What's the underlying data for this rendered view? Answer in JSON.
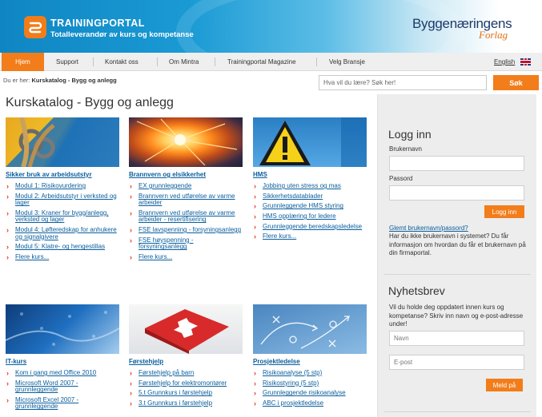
{
  "header": {
    "brand_name": "TRAININGPORTAL",
    "brand_tagline": "Totalleverandør av kurs og kompetanse",
    "partner_line1": "Byggenæringens",
    "partner_line2": "Forlag",
    "brand_color": "#f27d1a"
  },
  "nav": {
    "items": [
      {
        "label": "Hjem"
      },
      {
        "label": "Support"
      },
      {
        "label": "Kontakt oss"
      },
      {
        "label": "Om Mintra"
      },
      {
        "label": "Trainingportal Magazine"
      },
      {
        "label": "Velg Bransje"
      }
    ],
    "language": "English"
  },
  "breadcrumb": {
    "prefix": "Du er her:",
    "current": "Kurskatalog - Bygg og anlegg"
  },
  "search": {
    "placeholder": "Hva vil du lære? Søk her!",
    "button": "Søk"
  },
  "page_title": "Kurskatalog - Bygg og anlegg",
  "categories": [
    {
      "title": "Sikker bruk av arbeidsutstyr",
      "items": [
        "Modul 1: Risikovurdering",
        "Modul 2: Arbeidsutstyr i verksted og lager",
        "Modul 3: Kraner for bygg/anlegg, verksted og lager",
        "Modul 4: Løfteredskap for anhukere og signalgivere",
        "Modul 5: Klatre- og hengestillas",
        "Flere kurs..."
      ]
    },
    {
      "title": "Brannvern og elsikkerhet",
      "items": [
        "EX grunnleggende",
        "Brannvern ved utførelse av varme arbeider",
        "Brannvern ved utførelse av varme arbeider - resertifisering",
        "FSE lavspenning - forsyningsanlegg",
        "FSE høyspenning - forsyningsanlegg",
        "Flere kurs..."
      ]
    },
    {
      "title": "HMS",
      "items": [
        "Jobbing uten stress og mas",
        "Sikkerhetsdatablader",
        "Grunnleggende HMS styring",
        "HMS opplæring for ledere",
        "Grunnleggende beredskapsledelse",
        "Flere kurs..."
      ]
    },
    {
      "title": "IT-kurs",
      "items": [
        "Kom i gang med Office 2010",
        "Microsoft Word 2007 - grunnleggende",
        "Microsoft Excel 2007 - grunnleggende"
      ]
    },
    {
      "title": "Førstehjelp",
      "items": [
        "Førstehjelp på barn",
        "Førstehjelp for elektromontører",
        "5.t Grunnkurs i førstehjelp",
        "3.t Grunnkurs i førstehjelp"
      ]
    },
    {
      "title": "Prosjektledelse",
      "items": [
        "Risikoanalyse (5 stp)",
        "Risikostyring (5 stp)",
        "Grunnleggende risikoanalyse",
        "ABC i prosjektledelse"
      ]
    }
  ],
  "login": {
    "heading": "Logg inn",
    "username_label": "Brukernavn",
    "password_label": "Passord",
    "button": "Logg inn",
    "forgot_link": "Glemt brukernavn/passord?",
    "info_text": "Har du ikke brukernavn i systemet? Du får informasjon om hvordan du får et brukernavn på din firmaportal."
  },
  "newsletter": {
    "heading": "Nyhetsbrev",
    "text": "Vil du holde deg oppdatert innen kurs og kompetanse? Skriv inn navn og e-post-adresse under!",
    "name_placeholder": "Navn",
    "email_placeholder": "E-post",
    "button": "Meld på"
  }
}
